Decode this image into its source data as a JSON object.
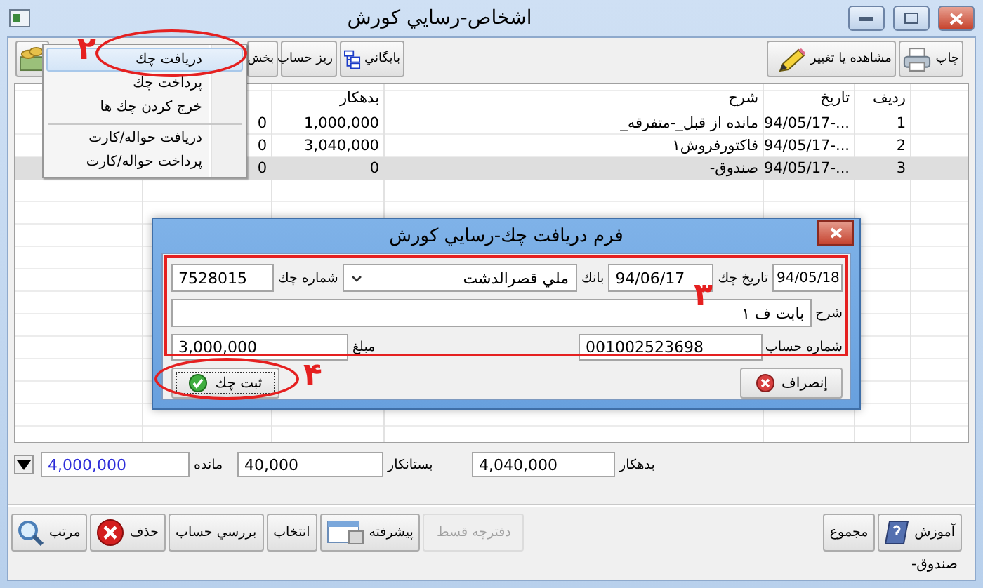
{
  "window": {
    "title": "اشخاص-رسايي كورش"
  },
  "toolbar": {
    "right": [
      {
        "label": "چاپ"
      },
      {
        "label": "مشاهده يا تغيير"
      }
    ],
    "left": [
      {
        "kind": "text",
        "label": "بايگاني"
      },
      {
        "kind": "text",
        "label": "ريز حساب"
      },
      {
        "kind": "text",
        "label": "بخش"
      },
      {
        "kind": "icon"
      }
    ]
  },
  "table": {
    "columns": [
      "رديف",
      "تاريخ",
      "شرح",
      "بدهكار"
    ],
    "rows": [
      {
        "cells": [
          "1",
          "...-94/05/17",
          "مانده از قبل_-متفرقه_",
          "1,000,000",
          "0"
        ],
        "selected": false
      },
      {
        "cells": [
          "2",
          "...-94/05/17",
          "فاكتورفروش۱",
          "3,040,000",
          "0"
        ],
        "selected": false
      },
      {
        "cells": [
          "3",
          "...-94/05/17",
          "صندوق-",
          "0",
          "0"
        ],
        "selected": true
      }
    ]
  },
  "menu": {
    "items": [
      {
        "label": "دريافت چك",
        "selected": true,
        "separator_before": false
      },
      {
        "label": "پرداخت چك",
        "selected": false,
        "separator_before": false
      },
      {
        "label": "خرج كردن چك ها",
        "selected": false,
        "separator_before": false
      },
      {
        "label": "دريافت حواله/كارت",
        "selected": false,
        "separator_before": true
      },
      {
        "label": "پرداخت حواله/كارت",
        "selected": false,
        "separator_before": false
      }
    ]
  },
  "dialog": {
    "title": "فرم دريافت چك-رسايي كورش",
    "check_date_label": "تاريخ چك",
    "date_value": "94/05/18",
    "check_date_value": "94/06/17",
    "bank_label": "بانك",
    "bank_value": "ملي قصرالدشت",
    "check_number_label": "شماره چك",
    "check_number_value": "7528015",
    "description_label": "شرح",
    "description_value": "بابت ف ۱",
    "account_label": "شماره حساب",
    "account_value": "001002523698",
    "amount_label": "مبلغ",
    "amount_value": "3,000,000",
    "cancel_button": "إنصراف",
    "save_button": "ثبت چك"
  },
  "totals": [
    {
      "label": "بدهكار",
      "value": "4,040,000"
    },
    {
      "label": "بستانكار",
      "value": "40,000"
    },
    {
      "label": "مانده",
      "value": "4,000,000"
    }
  ],
  "actions": {
    "right": [
      {
        "label": "آموزش",
        "disabled": false
      },
      {
        "label": "مجموع",
        "disabled": false
      }
    ],
    "left": [
      {
        "label": "دفترچه قسط",
        "disabled": true
      },
      {
        "label": "پيشرفته",
        "disabled": false
      },
      {
        "label": "انتخاب",
        "disabled": false
      },
      {
        "label": "بررسي حساب",
        "disabled": false
      },
      {
        "label": "حذف",
        "disabled": false
      },
      {
        "label": "مرتب",
        "disabled": false
      }
    ]
  },
  "status_bar": "صندوق-",
  "annotations": [
    {
      "kind": "ellipse",
      "number": "۲"
    },
    {
      "kind": "frame",
      "number": "۳"
    },
    {
      "kind": "ellipse",
      "number": "۴"
    }
  ]
}
